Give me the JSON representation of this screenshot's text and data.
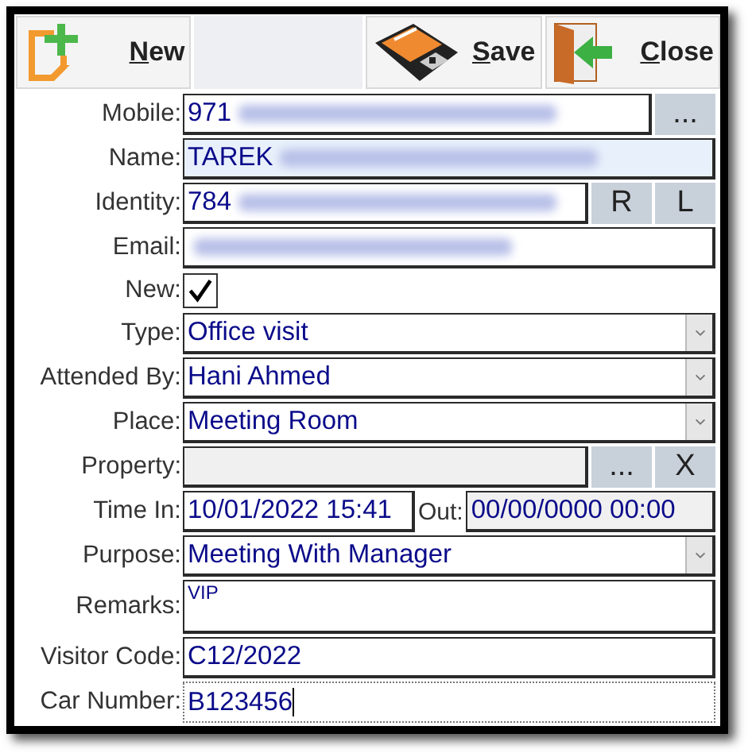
{
  "toolbar": [
    {
      "kind": "new",
      "mnemonic": "N",
      "rest": "ew"
    },
    {
      "kind": "save",
      "mnemonic": "S",
      "rest": "ave"
    },
    {
      "kind": "close",
      "mnemonic": "C",
      "rest": "lose"
    }
  ],
  "rows": [
    {
      "kind": "text",
      "label": "Mobile:",
      "value": "971",
      "redacted": true,
      "buttons": [
        "..."
      ]
    },
    {
      "kind": "text",
      "label": "Name:",
      "value": "TAREK",
      "redacted": true,
      "highlighted": true
    },
    {
      "kind": "text",
      "label": "Identity:",
      "value": "784",
      "redacted": true,
      "buttons": [
        "R",
        "L"
      ]
    },
    {
      "kind": "text",
      "label": "Email:",
      "redacted": true
    },
    {
      "kind": "checkbox",
      "label": "New:",
      "checked": true
    },
    {
      "kind": "combo",
      "label": "Type:",
      "value": "Office visit"
    },
    {
      "kind": "combo",
      "label": "Attended By:",
      "value": "Hani Ahmed"
    },
    {
      "kind": "combo",
      "label": "Place:",
      "value": "Meeting Room"
    },
    {
      "kind": "text",
      "label": "Property:",
      "disabled": true,
      "buttons": [
        "...",
        "X"
      ]
    },
    {
      "kind": "times",
      "label": "Time In:",
      "value": "10/01/2022 15:41",
      "out_label": "Out:",
      "out_value": "00/00/0000 00:00",
      "out_disabled": true
    },
    {
      "kind": "combo",
      "label": "Purpose:",
      "value": "Meeting With Manager"
    },
    {
      "kind": "memo",
      "label": "Remarks:",
      "value": "VIP"
    },
    {
      "kind": "text",
      "label": "Visitor Code:",
      "value": "C12/2022"
    },
    {
      "kind": "text",
      "label": "Car Number:",
      "value": "B123456",
      "focused": true
    }
  ]
}
